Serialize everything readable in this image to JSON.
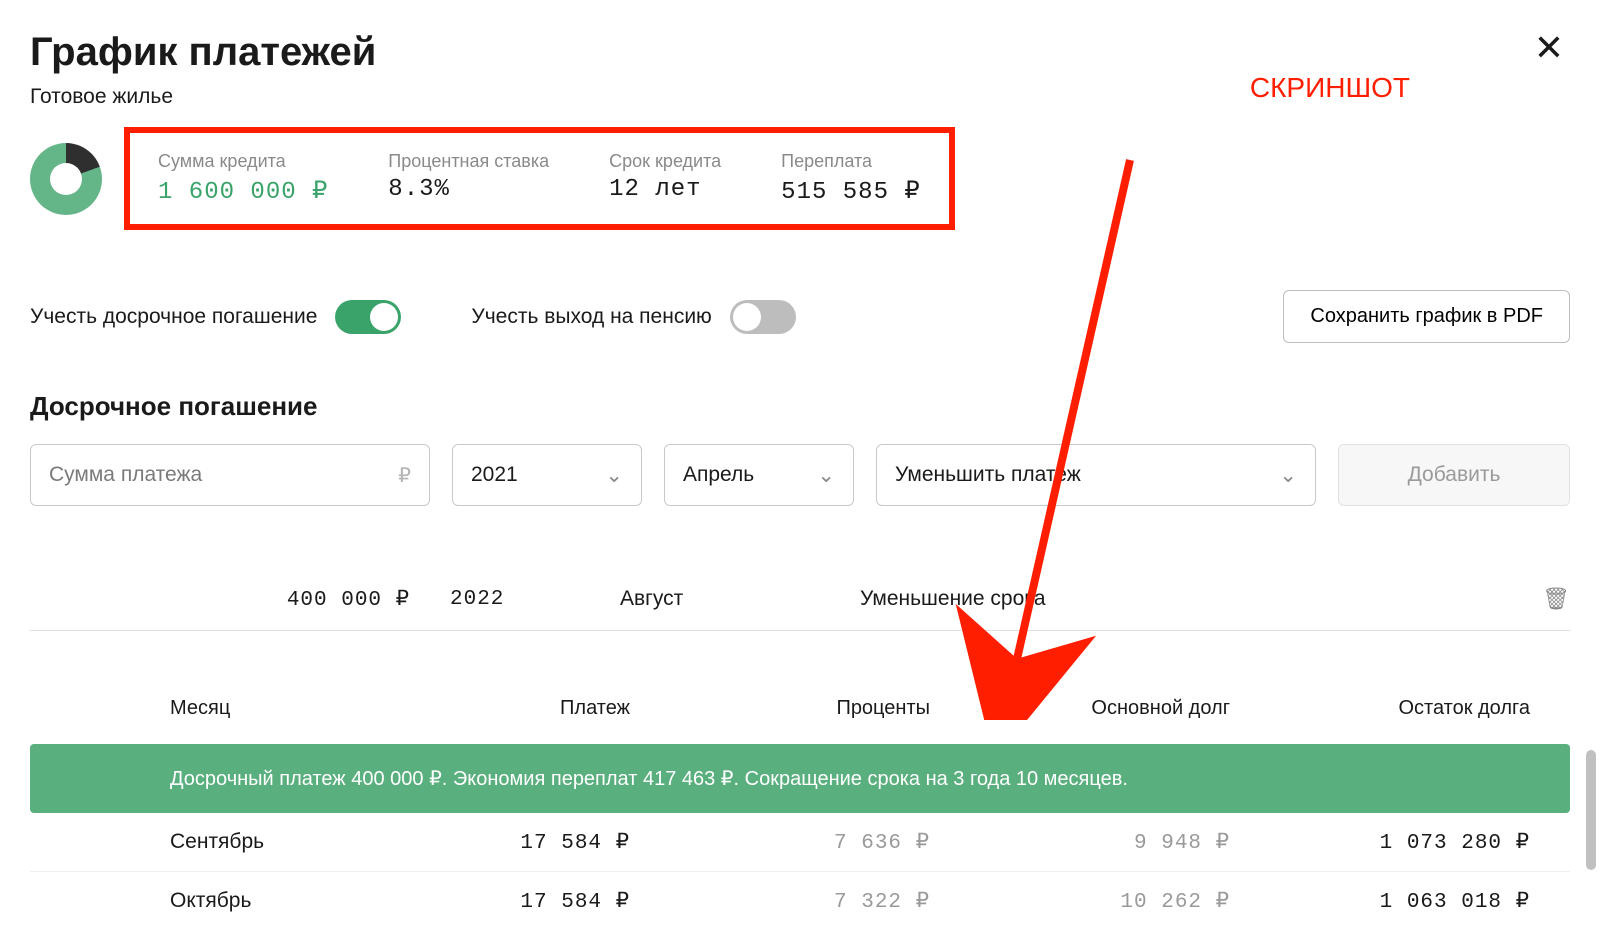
{
  "header": {
    "title": "График платежей",
    "subtitle": "Готовое жилье",
    "annotation": "СКРИНШОТ"
  },
  "summary": {
    "amount_label": "Сумма кредита",
    "amount_value": "1 600 000 ₽",
    "rate_label": "Процентная ставка",
    "rate_value": "8.3%",
    "term_label": "Срок кредита",
    "term_value": "12 лет",
    "overpay_label": "Переплата",
    "overpay_value": "515 585 ₽"
  },
  "toggles": {
    "early_label": "Учесть досрочное погашение",
    "pension_label": "Учесть выход на пенсию",
    "save_pdf": "Сохранить график в PDF"
  },
  "early_section": {
    "title": "Досрочное погашение",
    "amount_placeholder": "Сумма платежа",
    "year": "2021",
    "month": "Апрель",
    "mode": "Уменьшить платеж",
    "add": "Добавить"
  },
  "existing": {
    "amount": "400 000 ₽",
    "year": "2022",
    "month": "Август",
    "mode": "Уменьшение срока"
  },
  "table": {
    "headers": {
      "month": "Месяц",
      "payment": "Платеж",
      "interest": "Проценты",
      "principal": "Основной долг",
      "balance": "Остаток долга"
    },
    "banner": "Досрочный платеж 400 000 ₽. Экономия переплат 417 463 ₽. Сокращение срока на 3 года 10 месяцев.",
    "rows": [
      {
        "month": "Сентябрь",
        "payment": "17 584 ₽",
        "interest": "7 636 ₽",
        "principal": "9 948 ₽",
        "balance": "1 073 280 ₽"
      },
      {
        "month": "Октябрь",
        "payment": "17 584 ₽",
        "interest": "7 322 ₽",
        "principal": "10 262 ₽",
        "balance": "1 063 018 ₽"
      }
    ]
  },
  "icons": {
    "ruble": "₽"
  }
}
